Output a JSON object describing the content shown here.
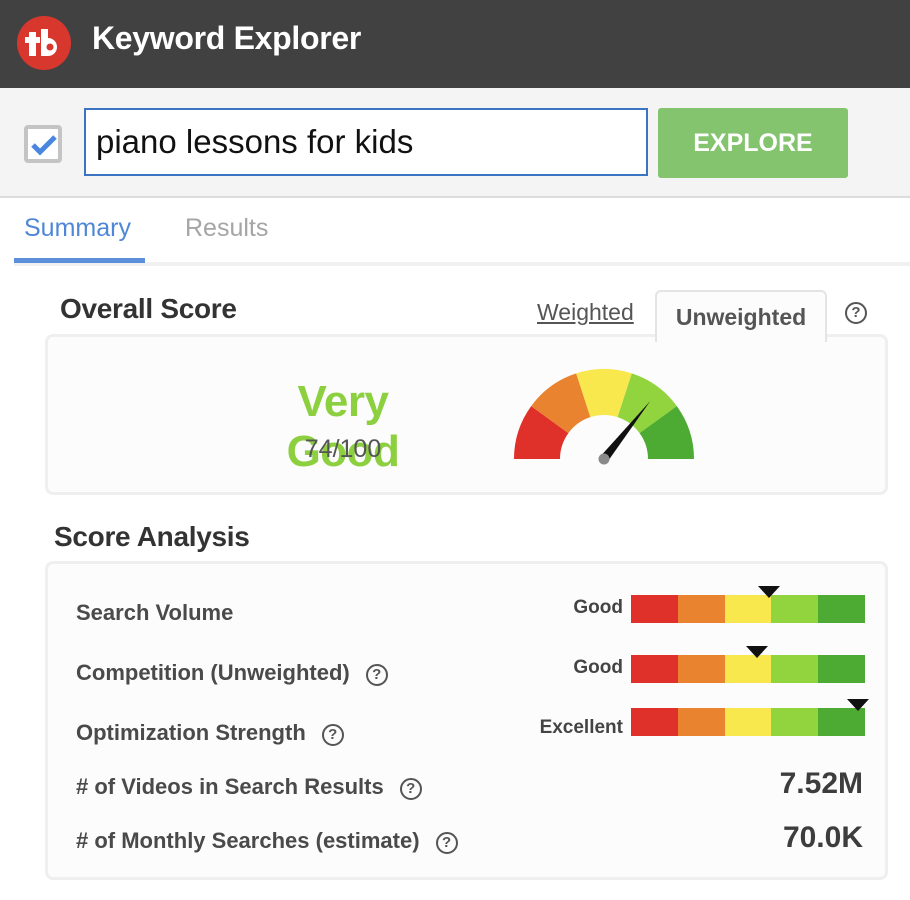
{
  "header": {
    "app_title": "Keyword Explorer",
    "logo_icon": "tubebuddy-logo-icon"
  },
  "search": {
    "checkbox_checked": true,
    "keyword_value": "piano lessons for kids",
    "explore_label": "EXPLORE"
  },
  "tabs": [
    {
      "label": "Summary",
      "active": true
    },
    {
      "label": "Results",
      "active": false
    }
  ],
  "overall": {
    "title": "Overall Score",
    "weighted_label": "Weighted",
    "unweighted_label": "Unweighted",
    "active_mode": "Unweighted",
    "help_icon": "question-circle-icon",
    "rating": "Very Good",
    "score_text": "74/100",
    "score": 74,
    "score_max": 100,
    "rating_color": "#8ccf3f",
    "gauge_colors": [
      "#e0302a",
      "#e9832f",
      "#f8e84d",
      "#92d43e",
      "#4daa33"
    ]
  },
  "analysis": {
    "title": "Score Analysis",
    "bar_colors": [
      "#e0302a",
      "#e9832f",
      "#f8e84d",
      "#92d43e",
      "#4daa33"
    ],
    "rows": [
      {
        "label": "Search Volume",
        "has_help": false,
        "rating": "Good",
        "level": 0.59
      },
      {
        "label": "Competition (Unweighted)",
        "has_help": true,
        "rating": "Good",
        "level": 0.54
      },
      {
        "label": "Optimization Strength",
        "has_help": true,
        "rating": "Excellent",
        "level": 0.97
      }
    ],
    "stats": [
      {
        "label": "# of Videos in Search Results",
        "has_help": true,
        "value": "7.52M"
      },
      {
        "label": "# of Monthly Searches (estimate)",
        "has_help": true,
        "value": "70.0K"
      }
    ],
    "help_glyph": "?"
  }
}
